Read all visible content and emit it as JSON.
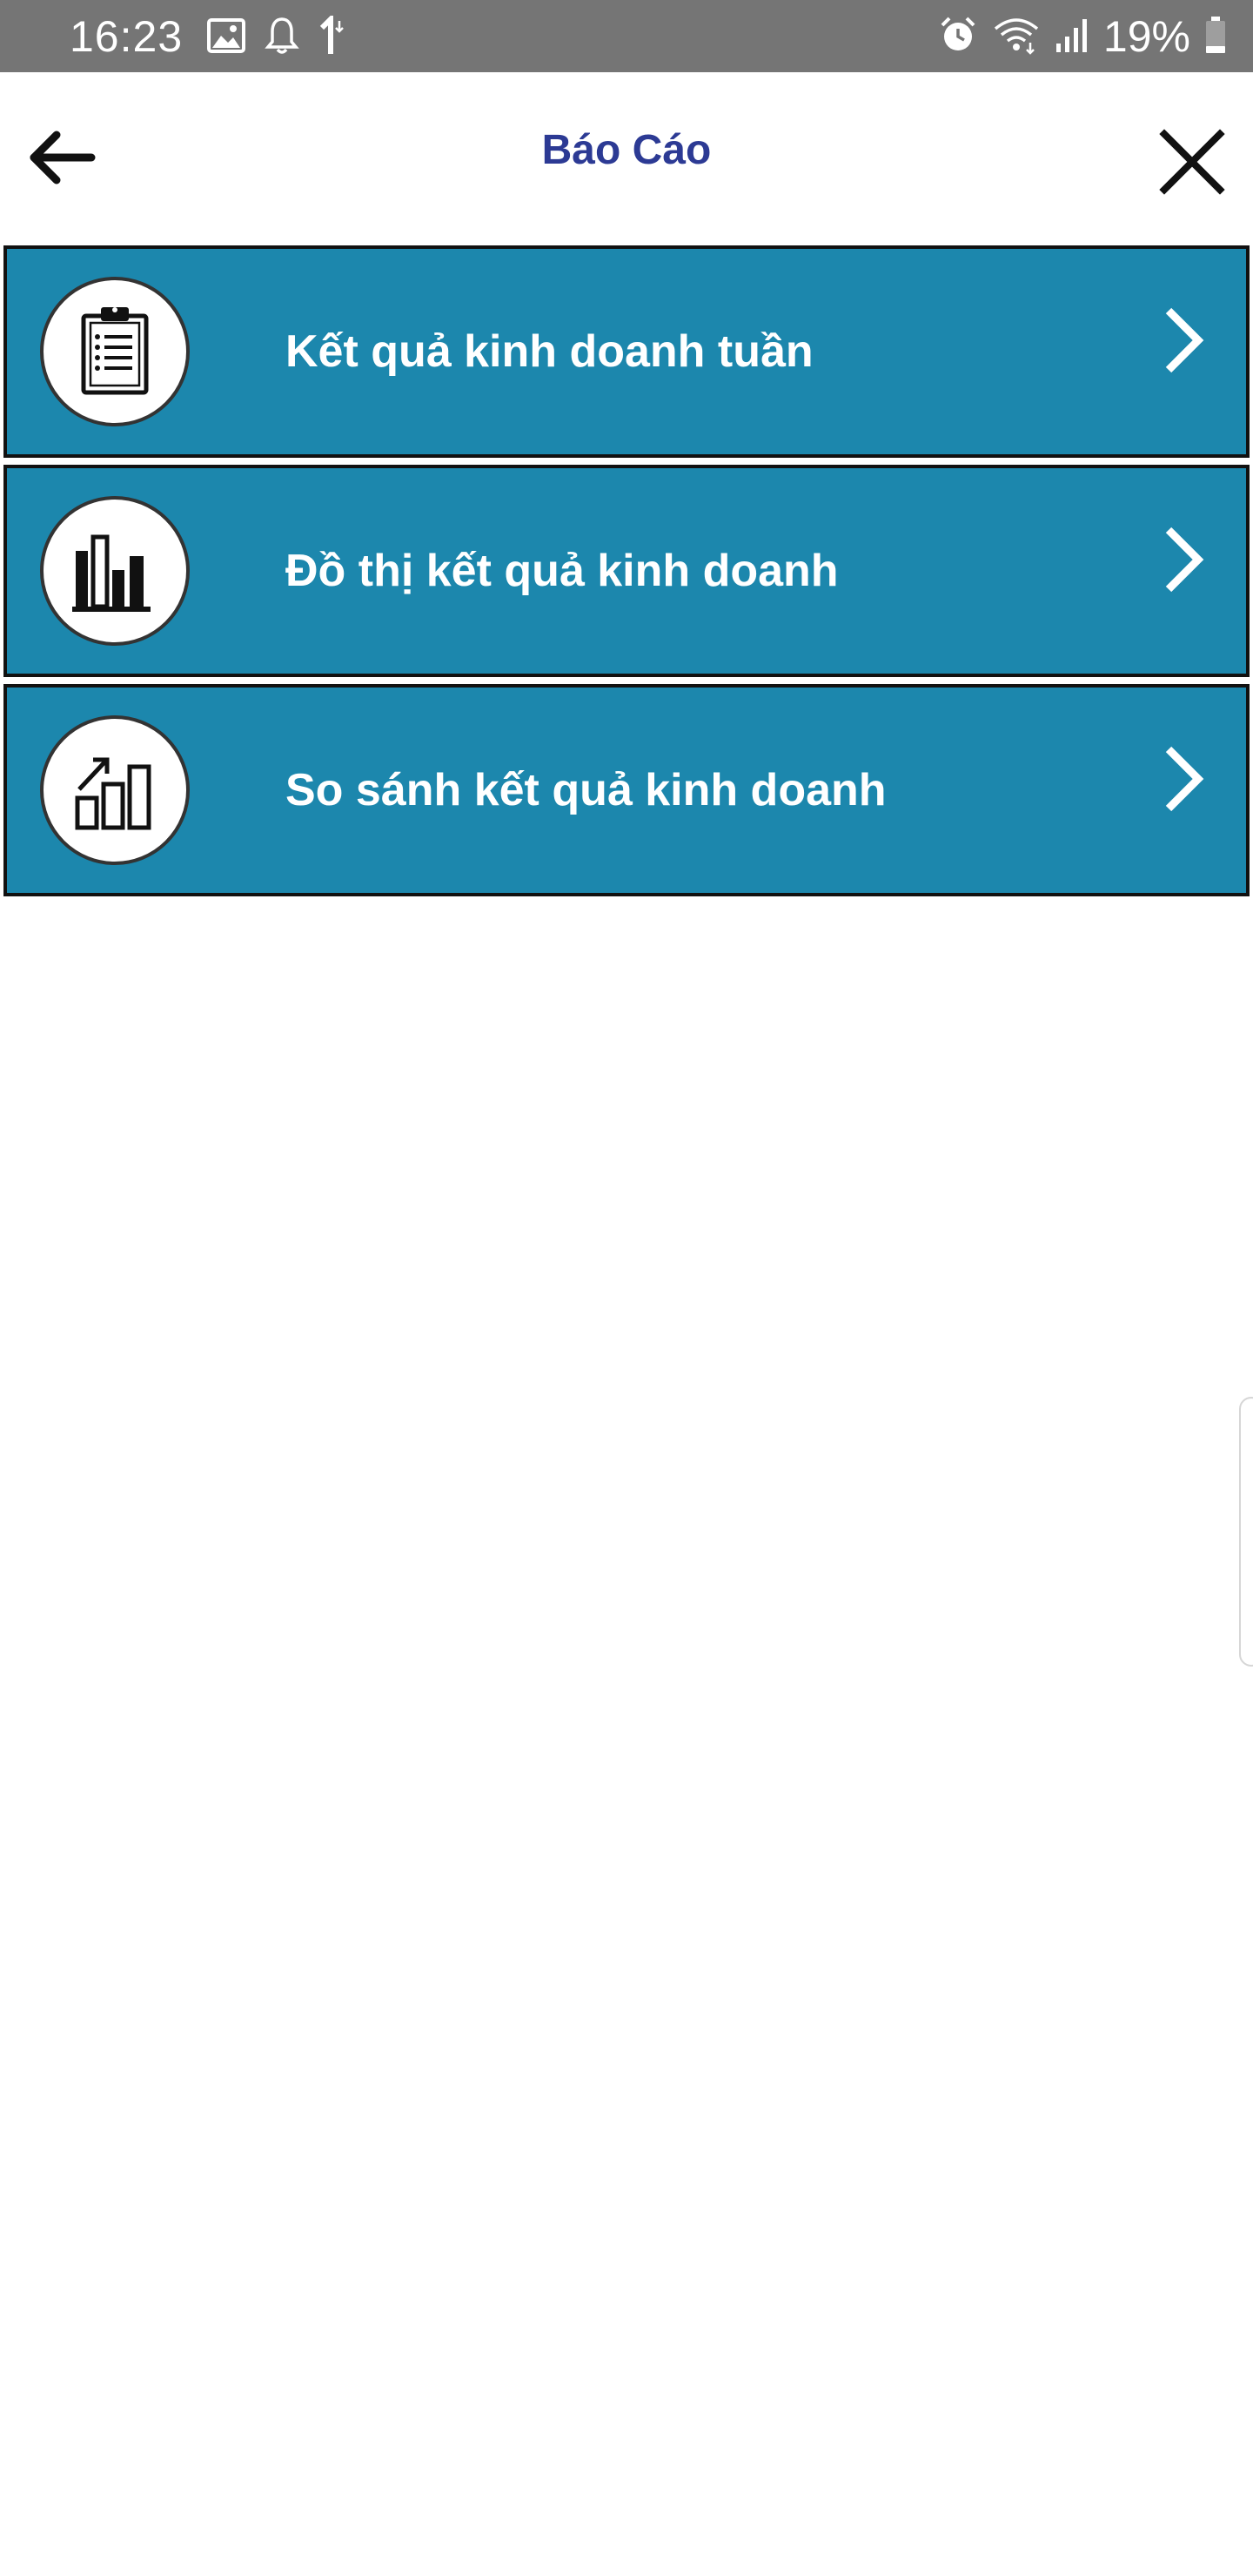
{
  "status_bar": {
    "time": "16:23",
    "battery": "19%",
    "left_icons": [
      "image-icon",
      "notification-bell-icon",
      "data-arrow-icon"
    ],
    "right_icons": [
      "alarm-icon",
      "wifi-icon",
      "signal-icon",
      "battery-icon"
    ]
  },
  "header": {
    "title": "Báo Cáo",
    "back_icon": "arrow-left-icon",
    "close_icon": "close-icon",
    "title_color": "#2c3a94"
  },
  "menu": {
    "items": [
      {
        "label": "Kết quả kinh doanh tuần",
        "icon": "clipboard-list-icon"
      },
      {
        "label": "Đồ thị kết quả kinh doanh",
        "icon": "bar-chart-icon"
      },
      {
        "label": "So sánh kết quả kinh doanh",
        "icon": "growth-chart-icon"
      }
    ],
    "item_color": "#1c87ad",
    "chevron_icon": "chevron-right-icon"
  }
}
